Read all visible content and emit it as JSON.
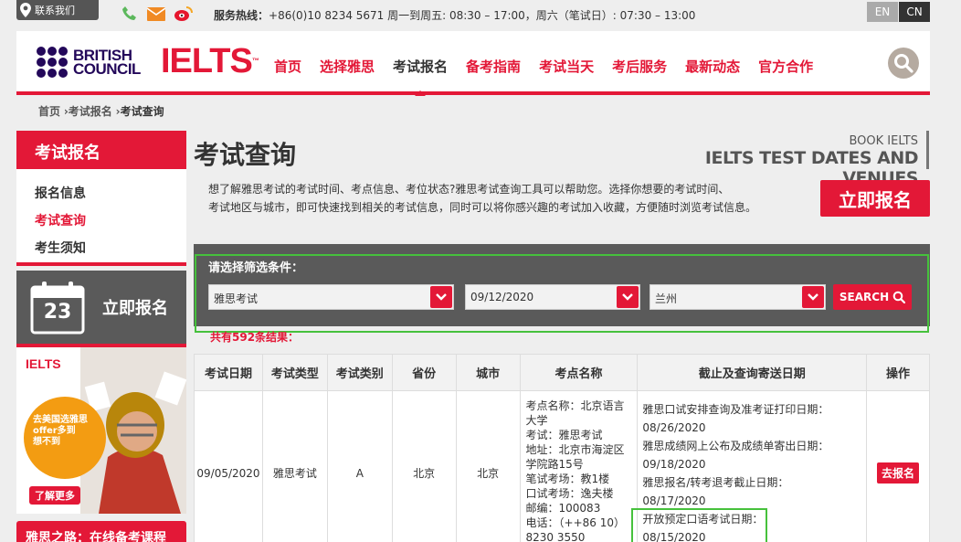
{
  "topbar": {
    "contact_label": "联系我们",
    "hotline_label": "服务热线：",
    "hotline_text": "+86(0)10 8234 5671 周一到周五: 08:30 – 17:00，周六（笔试日）: 07:30 – 13:00",
    "lang_en": "EN",
    "lang_cn": "CN"
  },
  "header": {
    "bc_line1": "BRITISH",
    "bc_line2": "COUNCIL",
    "ielts_logo": "IELTS",
    "ielts_tm": "™",
    "nav": [
      "首页",
      "选择雅思",
      "考试报名",
      "备考指南",
      "考试当天",
      "考后服务",
      "最新动态",
      "官方合作"
    ],
    "active_nav": "考试报名"
  },
  "breadcrumb": {
    "items": [
      "首页",
      "考试报名",
      "考试查询"
    ],
    "separator": "›"
  },
  "sidebar": {
    "title": "考试报名",
    "items": [
      "报名信息",
      "考试查询",
      "考生须知"
    ],
    "register_day": "23",
    "register_label": "立即报名",
    "ad_logo": "IELTS",
    "ad_line1": "去美国选雅思",
    "ad_line2": "offer多到",
    "ad_line3": "想不到",
    "ad_more": "了解更多",
    "course_banner": "雅思之路：在线备考课程"
  },
  "main": {
    "title": "考试查询",
    "book_sub": "BOOK IELTS",
    "book_title": "IELTS TEST DATES AND VENUES",
    "intro_line1": "想了解雅思考试的考试时间、考点信息、考位状态?雅思考试查询工具可以帮助您。选择你想要的考试时间、",
    "intro_line2": "考试地区与城市，即可快速找到相关的考试信息，同时可以将你感兴趣的考试加入收藏，方便随时浏览考试信息。",
    "register_button": "立即报名"
  },
  "filter": {
    "label": "请选择筛选条件：",
    "exam_type": "雅思考试",
    "date": "09/12/2020",
    "city": "兰州",
    "search_label": "SEARCH",
    "result_count": "共有592条结果："
  },
  "table": {
    "headers": [
      "考试日期",
      "考试类型",
      "考试类别",
      "省份",
      "城市",
      "考点名称",
      "截止及查询寄送日期",
      "操作"
    ],
    "row": {
      "date": "09/05/2020",
      "type": "雅思考试",
      "category": "A",
      "province": "北京",
      "city": "北京",
      "venue": [
        "考点名称：北京语言大学",
        "考试：雅思考试",
        "地址：北京市海淀区学院路15号",
        "笔试考场：教1楼",
        "口试考场：逸夫楼",
        "邮编：100083",
        "电话：（++86 10）8230 3550"
      ],
      "deadlines": [
        "雅思口试安排查询及准考证打印日期：",
        "08/26/2020",
        "雅思成绩网上公布及成绩单寄出日期：",
        "09/18/2020",
        "雅思报名/转考退考截止日期：",
        "08/17/2020",
        "开放预定口语考试日期：",
        "08/15/2020"
      ],
      "action": "去报名"
    }
  },
  "colors": {
    "brand_red": "#e31837",
    "bc_navy": "#23085a",
    "highlight_green": "#46c13c"
  }
}
